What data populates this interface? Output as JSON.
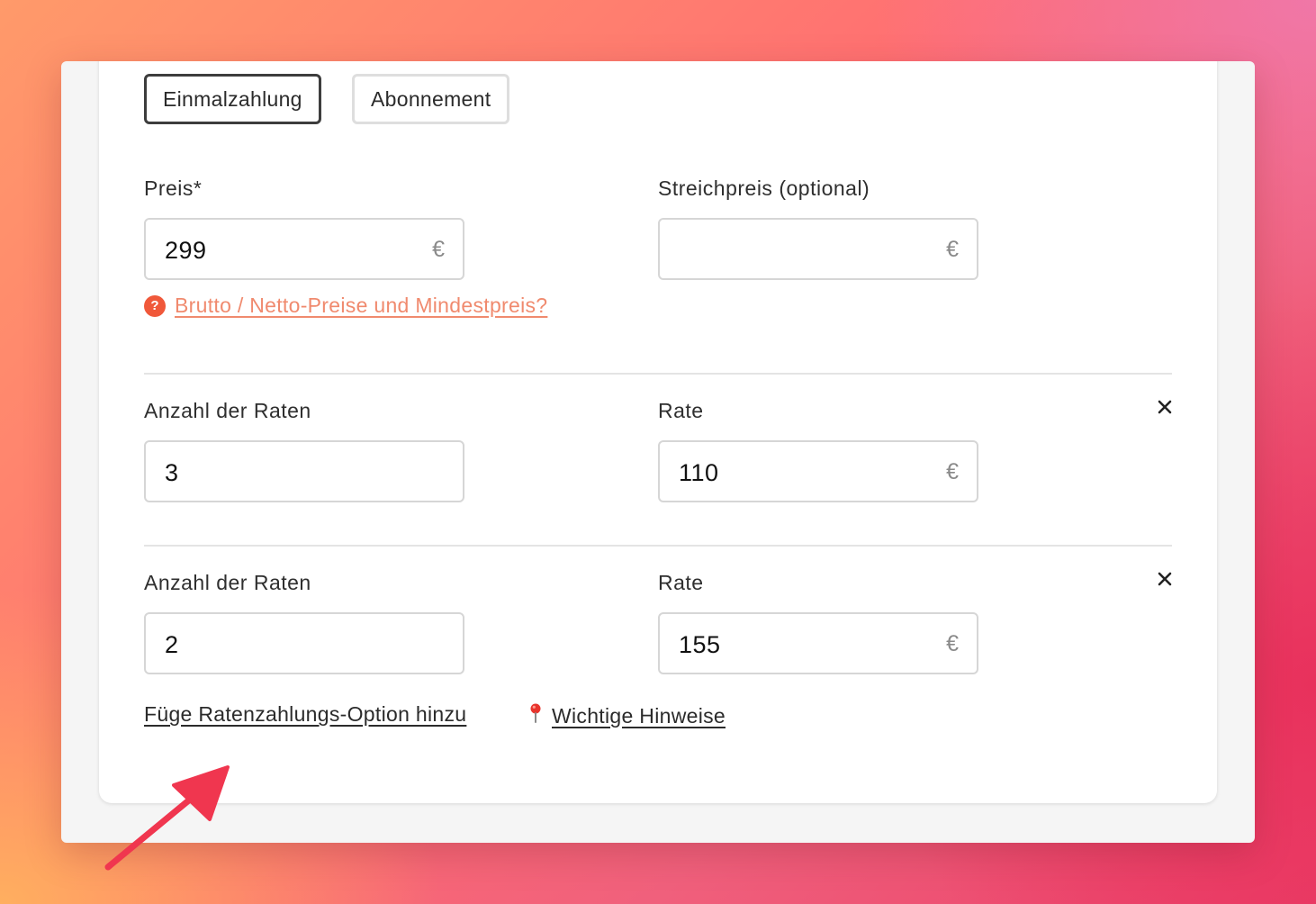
{
  "pricing_type": {
    "one_time_label": "Einmalzahlung",
    "subscription_label": "Abonnement",
    "selected": "Einmalzahlung"
  },
  "price": {
    "label": "Preis*",
    "value": "299",
    "currency": "€"
  },
  "strike_price": {
    "label": "Streichpreis (optional)",
    "value": "",
    "currency": "€"
  },
  "help": {
    "icon": "question-icon",
    "icon_glyph": "?",
    "link_text": "Brutto / Netto-Preise und Mindestpreis?"
  },
  "installments": [
    {
      "count_label": "Anzahl der Raten",
      "count_value": "3",
      "rate_label": "Rate",
      "rate_value": "110",
      "currency": "€",
      "remove_icon": "close-icon"
    },
    {
      "count_label": "Anzahl der Raten",
      "count_value": "2",
      "rate_label": "Rate",
      "rate_value": "155",
      "currency": "€",
      "remove_icon": "close-icon"
    }
  ],
  "footer": {
    "add_installment_label": "Füge Ratenzahlungs-Option hinzu",
    "notes_icon": "pushpin-icon",
    "notes_label": "Wichtige Hinweise"
  },
  "colors": {
    "accent": "#f0583a",
    "link": "#f08a6e",
    "annotation_arrow": "#f0364f"
  }
}
